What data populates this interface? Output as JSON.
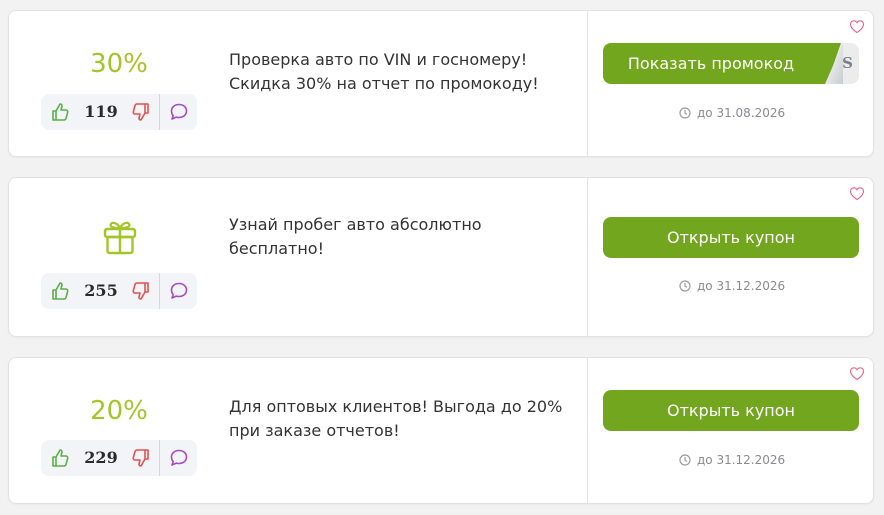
{
  "coupons": [
    {
      "discount": "30%",
      "votes": "119",
      "description_line1": "Проверка авто по VIN и госномеру!",
      "description_line2": "Скидка 30% на отчет по промокоду!",
      "button_label": "Показать промокод",
      "code_hint": "S",
      "expiry": "до 31.08.2026"
    },
    {
      "icon": "gift-icon",
      "votes": "255",
      "description_line1": "Узнай пробег авто абсолютно",
      "description_line2": "бесплатно!",
      "button_label": "Открыть купон",
      "expiry": "до 31.12.2026"
    },
    {
      "discount": "20%",
      "votes": "229",
      "description_line1": "Для оптовых клиентов! Выгода до 20%",
      "description_line2": "при заказе отчетов!",
      "button_label": "Открыть купон",
      "expiry": "до 31.12.2026"
    }
  ],
  "colors": {
    "accent_green": "#72a61e",
    "discount_green": "#a3c527",
    "like_green": "#5cae4a",
    "dislike_red": "#e0524f",
    "comment_purple": "#a64cc2",
    "favorite_pink": "#e86a8a"
  },
  "icons": [
    "thumbs-up-icon",
    "thumbs-down-icon",
    "comment-icon",
    "clock-icon",
    "heart-icon",
    "gift-icon"
  ]
}
